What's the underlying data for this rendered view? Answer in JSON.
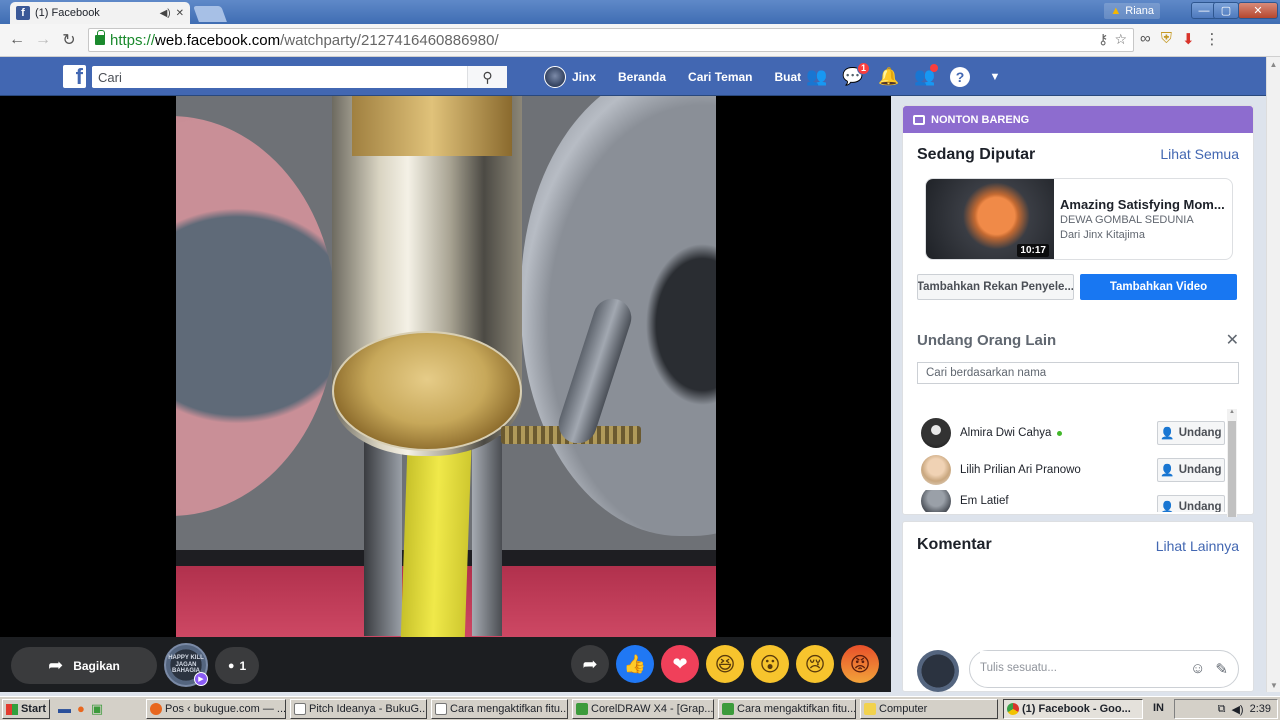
{
  "browser": {
    "tab_title": "(1) Facebook",
    "profile_name": "Riana",
    "url_scheme": "https://",
    "url_host": "web.facebook.com",
    "url_path": "/watchparty/2127416460886980/"
  },
  "fb": {
    "search_placeholder": "Cari",
    "nav": {
      "profile": "Jinx",
      "home": "Beranda",
      "find_friends": "Cari Teman",
      "create": "Buat"
    },
    "messenger_badge": "1",
    "brand_color": "#4267b2"
  },
  "video": {
    "share_label": "Bagikan",
    "host_avatar_text": "HAPPY KILL JAGAN BAHAGIA",
    "viewer_count": "1"
  },
  "sidebar": {
    "watch_party_label": "NONTON BARENG",
    "now_playing_title": "Sedang Diputar",
    "see_all": "Lihat Semua",
    "now_playing": {
      "title": "Amazing Satisfying Mom...",
      "channel": "DEWA GOMBAL SEDUNIA",
      "from": "Dari Jinx Kitajima",
      "duration": "10:17"
    },
    "add_cohost_label": "Tambahkan Rekan Penyele...",
    "add_video_label": "Tambahkan Video",
    "invite_title": "Undang Orang Lain",
    "invite_placeholder": "Cari berdasarkan nama",
    "invite_button": "Undang",
    "friends": [
      {
        "name": "Almira Dwi Cahya",
        "online": true
      },
      {
        "name": "Lilih Prilian Ari Pranowo",
        "online": false
      },
      {
        "name": "Em Latief",
        "online": false
      }
    ],
    "comments_title": "Komentar",
    "see_more": "Lihat Lainnya",
    "comment_placeholder": "Tulis sesuatu..."
  },
  "taskbar": {
    "start": "Start",
    "tasks": [
      "Pos ‹ bukugue.com — ...",
      "Pitch Ideanya - BukuG...",
      "Cara mengaktifkan fitu...",
      "CorelDRAW X4 - [Grap...",
      "Cara mengaktifkan fitu...",
      "Computer",
      "(1) Facebook - Goo..."
    ],
    "lang": "IN",
    "clock": "2:39"
  }
}
